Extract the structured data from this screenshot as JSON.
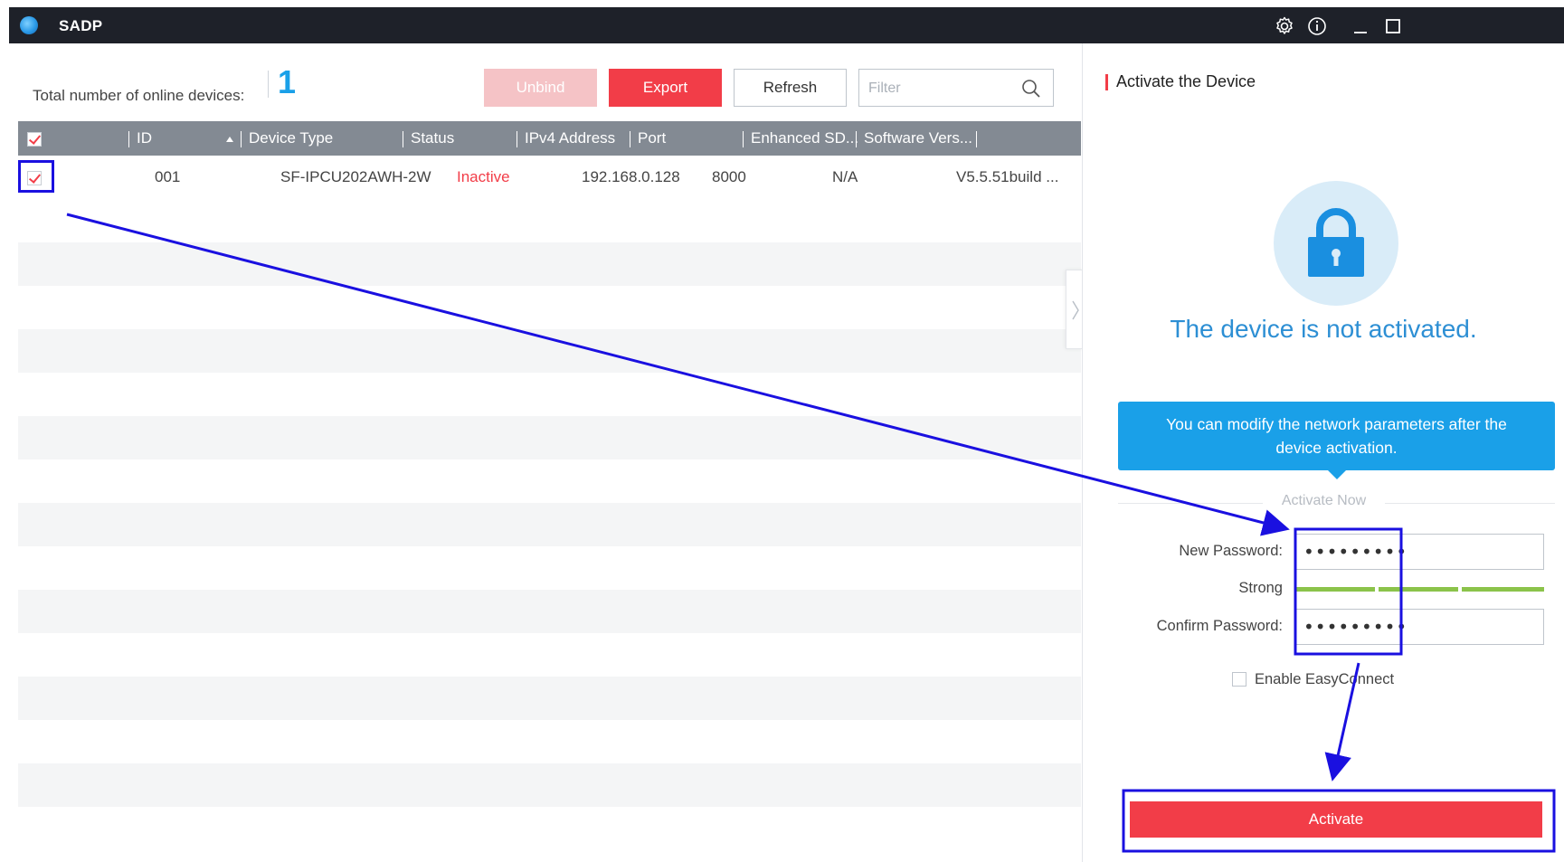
{
  "app": {
    "title": "SADP"
  },
  "toolbar": {
    "online_label": "Total number of online devices:",
    "online_count": "1",
    "unbind_label": "Unbind",
    "export_label": "Export",
    "refresh_label": "Refresh",
    "filter_placeholder": "Filter"
  },
  "table": {
    "columns": [
      "ID",
      "Device Type",
      "Status",
      "IPv4 Address",
      "Port",
      "Enhanced SD...",
      "Software Vers..."
    ],
    "rows": [
      {
        "id": "001",
        "device_type": "SF-IPCU202AWH-2W",
        "status": "Inactive",
        "ipv4": "192.168.0.128",
        "port": "8000",
        "enhanced": "N/A",
        "software": "V5.5.51build ..."
      }
    ]
  },
  "panel": {
    "title": "Activate the Device",
    "status_message": "The device is not activated.",
    "tooltip_line1": "You can modify the network parameters after the",
    "tooltip_line2": "device activation.",
    "activate_now": "Activate Now",
    "new_password_label": "New Password:",
    "new_password_value": "•••••••••",
    "strength_label": "Strong",
    "confirm_password_label": "Confirm Password:",
    "confirm_password_value": "•••••••••",
    "easyconnect_label": "Enable EasyConnect",
    "activate_label": "Activate"
  },
  "colors": {
    "accent_red": "#f23d48",
    "accent_blue": "#1aa0e8",
    "title_bar": "#1e2129",
    "table_header": "#838a93",
    "annotation_blue": "#1a10e0",
    "strength_green": "#8bc34a"
  },
  "icons": {
    "app": "sadp-logo-icon",
    "settings": "gear-icon",
    "about": "info-icon",
    "minimize": "minimize-icon",
    "maximize": "maximize-icon",
    "search": "search-icon",
    "lock": "lock-icon",
    "collapse": "chevron-right-icon"
  }
}
